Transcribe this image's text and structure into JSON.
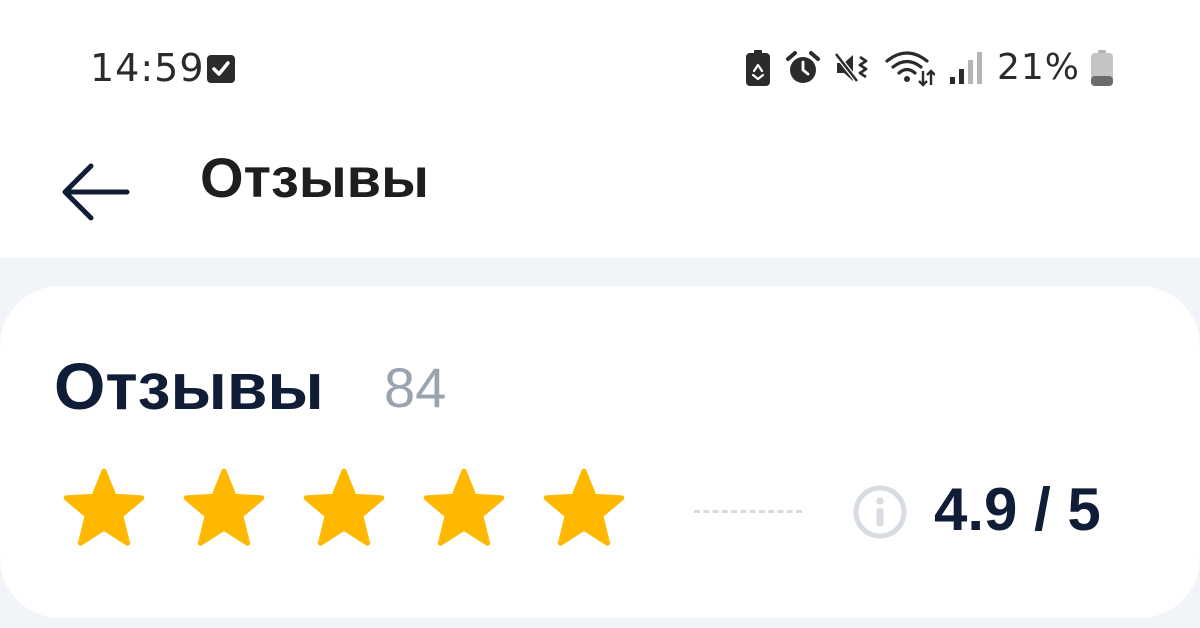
{
  "status_bar": {
    "time": "14:59",
    "battery_percent": "21%",
    "icons": [
      "checkbox-notification-icon",
      "battery-saver-icon",
      "alarm-icon",
      "mute-icon",
      "wifi-icon",
      "signal-icon",
      "battery-icon"
    ]
  },
  "header": {
    "title": "Отзывы",
    "back_icon": "arrow-left-icon"
  },
  "reviews_card": {
    "title": "Отзывы",
    "count": "84",
    "stars_filled": 5,
    "stars_total": 5,
    "rating_label": "4.9 / 5",
    "info_icon": "info-circle-icon"
  },
  "colors": {
    "star": "#FFB800",
    "title_text": "#0F1E36",
    "count_text": "#9AA3B0",
    "page_background": "#F1F4F9",
    "info_icon": "#D7DCE3"
  }
}
